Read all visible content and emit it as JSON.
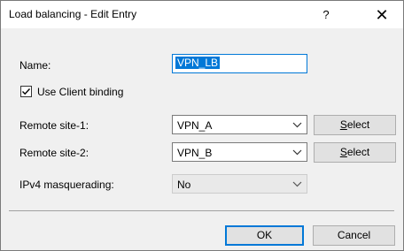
{
  "window": {
    "title": "Load balancing - Edit Entry",
    "help_glyph": "?",
    "close_glyph": "✕"
  },
  "form": {
    "name_label": "Name:",
    "name_value": "VPN_LB",
    "client_binding_label": "Use Client binding",
    "client_binding_checked": true,
    "remote1_label": "Remote site-1:",
    "remote1_value": "VPN_A",
    "remote2_label": "Remote site-2:",
    "remote2_value": "VPN_B",
    "select_label_first": "S",
    "select_label_rest": "elect",
    "ipv4_label": "IPv4 masquerading:",
    "ipv4_value": "No"
  },
  "footer": {
    "ok_label": "OK",
    "cancel_label": "Cancel"
  },
  "colors": {
    "accent": "#0078d7",
    "dialog_bg": "#f0f0f0",
    "button_bg": "#e1e1e1"
  },
  "icons": [
    "help-icon",
    "close-icon",
    "check-icon",
    "chevron-down-icon"
  ]
}
